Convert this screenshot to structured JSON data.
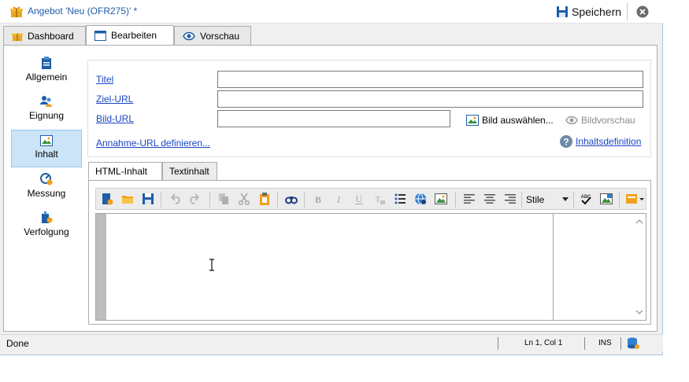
{
  "window": {
    "title": "Angebot 'Neu  (OFR275)' *",
    "save_label": "Speichern"
  },
  "tabs": [
    {
      "label": "Dashboard",
      "active": false
    },
    {
      "label": "Bearbeiten",
      "active": true
    },
    {
      "label": "Vorschau",
      "active": false
    }
  ],
  "sidebar": {
    "items": [
      {
        "label": "Allgemein",
        "icon": "clipboard-icon",
        "active": false
      },
      {
        "label": "Eignung",
        "icon": "people-icon",
        "active": false
      },
      {
        "label": "Inhalt",
        "icon": "image-icon",
        "active": true
      },
      {
        "label": "Messung",
        "icon": "measure-icon",
        "active": false
      },
      {
        "label": "Verfolgung",
        "icon": "tracking-icon",
        "active": false
      }
    ]
  },
  "form": {
    "title_label": "Titel",
    "title_value": "",
    "target_url_label": "Ziel-URL",
    "target_url_value": "",
    "image_url_label": "Bild-URL",
    "image_url_value": "",
    "choose_image_label": "Bild auswählen...",
    "image_preview_label": "Bildvorschau",
    "accept_url_label": "Annahme-URL definieren...",
    "content_definition_label": "Inhaltsdefinition"
  },
  "content_tabs": [
    {
      "label": "HTML-Inhalt",
      "active": true
    },
    {
      "label": "Textinhalt",
      "active": false
    }
  ],
  "editor": {
    "style_select": "Stile",
    "toolbar_icons": [
      "new-doc-icon",
      "open-folder-icon",
      "save-icon",
      "undo-icon",
      "redo-icon",
      "copy-icon",
      "cut-icon",
      "paste-icon",
      "find-icon",
      "bold-icon",
      "italic-icon",
      "underline-icon",
      "clear-format-icon",
      "bullet-list-icon",
      "link-icon",
      "insert-image-icon",
      "align-left-icon",
      "align-center-icon",
      "align-right-icon",
      "spellcheck-icon",
      "image-props-icon",
      "more-icon"
    ]
  },
  "status": {
    "text": "Done",
    "position": "Ln 1, Col 1",
    "mode": "INS"
  },
  "colors": {
    "link": "#1a45c5",
    "title": "#1f5ea8",
    "active_nav": "#cce4f7"
  }
}
